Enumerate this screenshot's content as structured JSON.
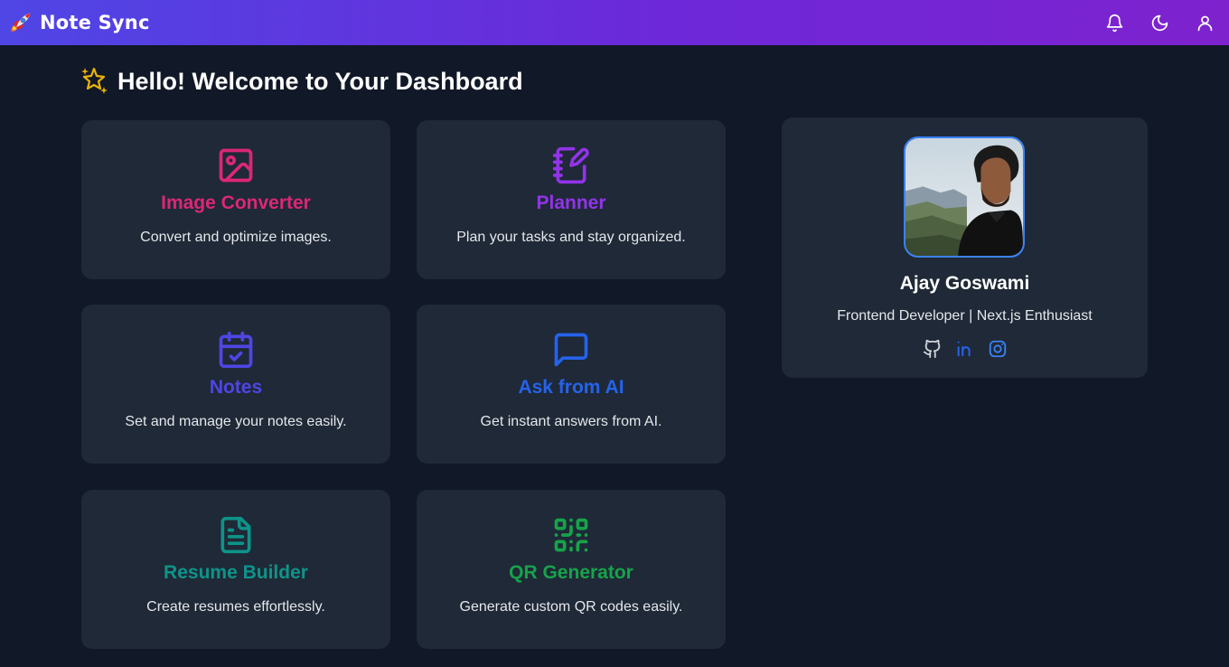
{
  "header": {
    "brand": "Note Sync",
    "logo_icon": "rocket-icon",
    "actions": [
      {
        "name": "bell-icon"
      },
      {
        "name": "moon-icon"
      },
      {
        "name": "user-icon"
      }
    ]
  },
  "page": {
    "title": "Hello! Welcome to Your Dashboard",
    "title_icon": "sparkles-icon"
  },
  "cards": [
    {
      "title": "Image Converter",
      "description": "Convert and optimize images.",
      "icon": "image-icon",
      "color": "#db2777"
    },
    {
      "title": "Planner",
      "description": "Plan your tasks and stay organized.",
      "icon": "notebook-pen-icon",
      "color": "#9333ea"
    },
    {
      "title": "Notes",
      "description": "Set and manage your notes easily.",
      "icon": "calendar-check-icon",
      "color": "#4f46e5"
    },
    {
      "title": "Ask from AI",
      "description": "Get instant answers from AI.",
      "icon": "message-icon",
      "color": "#2563eb"
    },
    {
      "title": "Resume Builder",
      "description": "Create resumes effortlessly.",
      "icon": "file-text-icon",
      "color": "#0d9488"
    },
    {
      "title": "QR Generator",
      "description": "Generate custom QR codes easily.",
      "icon": "qr-code-icon",
      "color": "#16a34a"
    }
  ],
  "profile": {
    "name": "Ajay Goswami",
    "role": "Frontend Developer | Next.js Enthusiast",
    "avatar": "profile-photo",
    "socials": [
      {
        "name": "github-icon",
        "color": "#d1d5db"
      },
      {
        "name": "linkedin-icon",
        "color": "#2563eb"
      },
      {
        "name": "instagram-icon",
        "color": "#3b82f6"
      }
    ]
  },
  "colors": {
    "background": "#111827",
    "card": "#1f2937",
    "header_start": "#4f46e5",
    "header_end": "#7e22ce"
  }
}
